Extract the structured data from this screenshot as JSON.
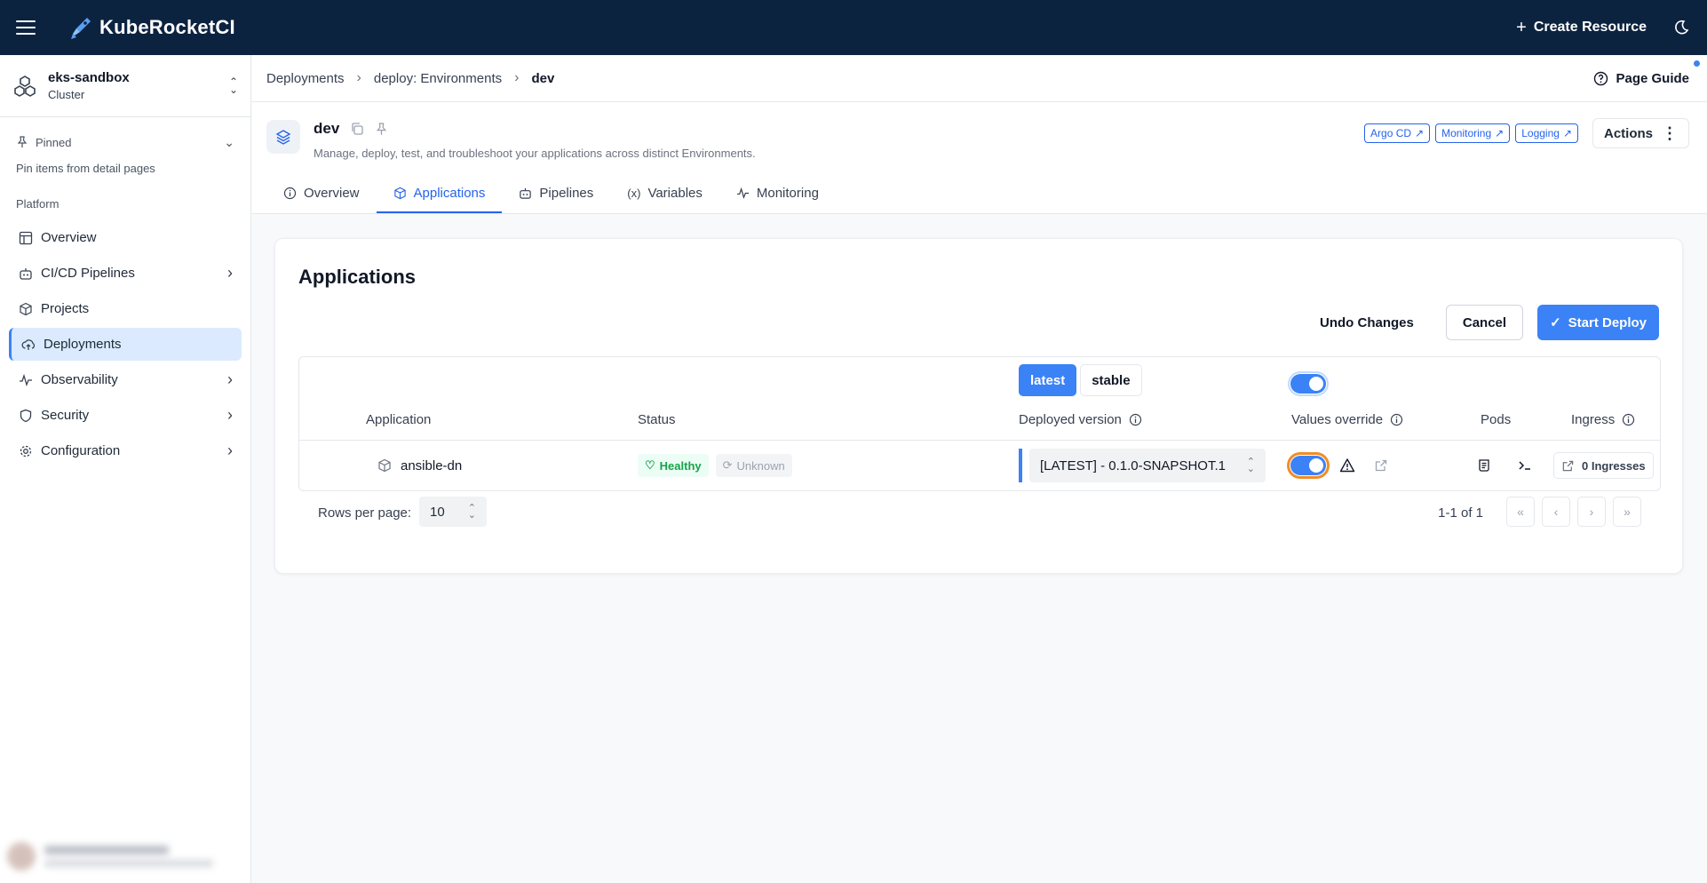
{
  "app": {
    "name": "KubeRocketCI",
    "create_label": "Create Resource"
  },
  "sidebar": {
    "cluster_name": "eks-sandbox",
    "cluster_type": "Cluster",
    "pinned_label": "Pinned",
    "pinned_hint": "Pin items from detail pages",
    "section": "Platform",
    "items": [
      {
        "label": "Overview",
        "icon": "layout-icon"
      },
      {
        "label": "CI/CD Pipelines",
        "icon": "robot-icon"
      },
      {
        "label": "Projects",
        "icon": "box-icon"
      },
      {
        "label": "Deployments",
        "icon": "cloud-upload-icon"
      },
      {
        "label": "Observability",
        "icon": "activity-icon"
      },
      {
        "label": "Security",
        "icon": "shield-icon"
      },
      {
        "label": "Configuration",
        "icon": "gear-icon"
      }
    ]
  },
  "breadcrumb": [
    "Deployments",
    "deploy: Environments",
    "dev"
  ],
  "page_guide": "Page Guide",
  "env": {
    "name": "dev",
    "description": "Manage, deploy, test, and troubleshoot your applications across distinct Environments.",
    "links": [
      "Argo CD",
      "Monitoring",
      "Logging"
    ],
    "actions_label": "Actions"
  },
  "tabs": [
    "Overview",
    "Applications",
    "Pipelines",
    "Variables",
    "Monitoring"
  ],
  "card": {
    "title": "Applications",
    "undo_label": "Undo Changes",
    "cancel_label": "Cancel",
    "deploy_label": "Start Deploy"
  },
  "table": {
    "seg_latest": "latest",
    "seg_stable": "stable",
    "headers": {
      "application": "Application",
      "status": "Status",
      "deployed_version": "Deployed version",
      "values_override": "Values override",
      "pods": "Pods",
      "ingress": "Ingress"
    },
    "rows": [
      {
        "application": "ansible-dn",
        "health": "Healthy",
        "sync": "Unknown",
        "version": "[LATEST] - 0.1.0-SNAPSHOT.1",
        "ingress": "0 Ingresses"
      }
    ]
  },
  "pagination": {
    "rows_label": "Rows per page:",
    "rows_value": "10",
    "range": "1-1 of 1"
  },
  "colors": {
    "topbar": "#0c2340",
    "primary": "#3b82f6",
    "highlight": "#f28c28"
  }
}
